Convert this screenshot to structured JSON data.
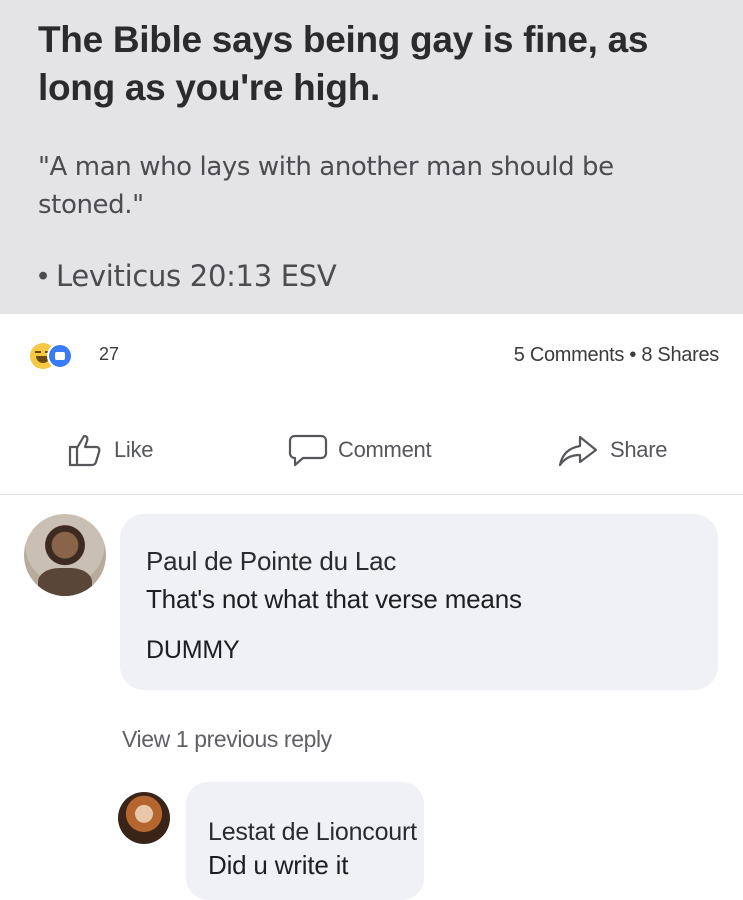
{
  "post": {
    "headline": "The Bible says being gay is fine, as long as you're high.",
    "quote": "\"A man who lays with another man should be stoned.\"",
    "citation_bullet": "•",
    "citation": "Leviticus 20:13 ESV"
  },
  "reactions": {
    "icons": [
      "haha-icon",
      "like-icon"
    ],
    "count": "27",
    "engagement": "5 Comments • 8 Shares"
  },
  "actions": {
    "like_label": "Like",
    "comment_label": "Comment",
    "share_label": "Share"
  },
  "comments": [
    {
      "author": "Paul de Pointe du Lac",
      "line1": "That's not what that verse means",
      "line2": "DUMMY"
    }
  ],
  "view_previous": "View 1 previous reply",
  "reply": {
    "author": "Lestat de Lioncourt",
    "text": "Did u write it"
  }
}
